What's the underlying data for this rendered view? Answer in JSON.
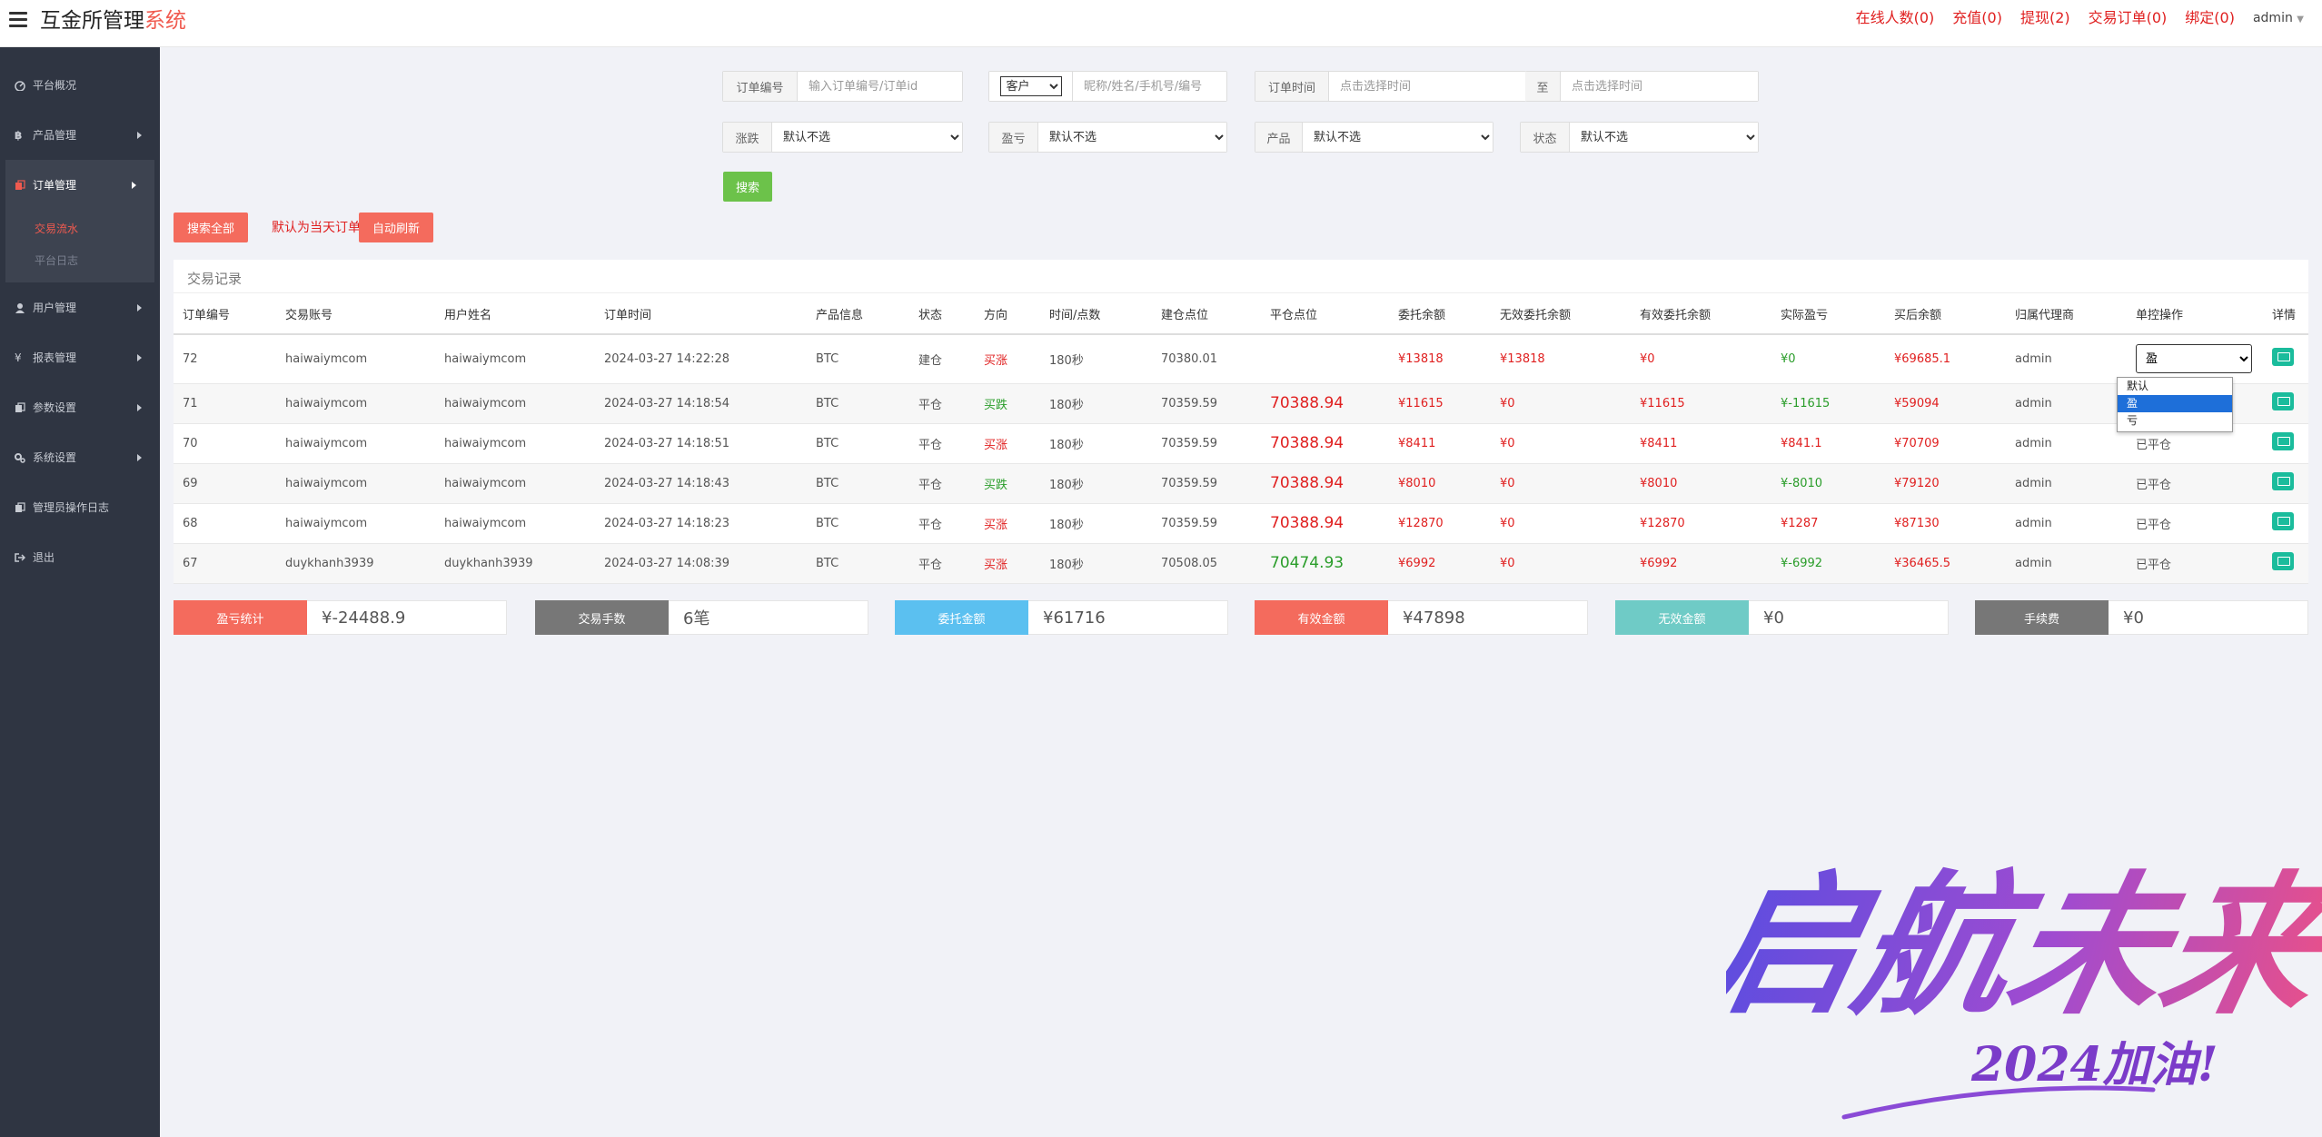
{
  "header": {
    "title_main": "互金所管理",
    "title_accent": "系统",
    "nav": [
      "在线人数(0)",
      "充值(0)",
      "提现(2)",
      "交易订单(0)",
      "绑定(0)"
    ],
    "user": "admin"
  },
  "sidebar": {
    "items": [
      {
        "label": "平台概况",
        "icon": "dashboard-icon"
      },
      {
        "label": "产品管理",
        "icon": "bitcoin-icon"
      },
      {
        "label": "订单管理",
        "icon": "copy-icon"
      },
      {
        "label": "用户管理",
        "icon": "user-icon"
      },
      {
        "label": "报表管理",
        "icon": "yen-icon"
      },
      {
        "label": "参数设置",
        "icon": "copy-icon"
      },
      {
        "label": "系统设置",
        "icon": "gears-icon"
      },
      {
        "label": "管理员操作日志",
        "icon": "copy-icon"
      },
      {
        "label": "退出",
        "icon": "sign-out-icon"
      }
    ],
    "sub": [
      "交易流水",
      "平台日志"
    ]
  },
  "filters": {
    "order_no_label": "订单编号",
    "order_no_placeholder": "输入订单编号/订单id",
    "user_type": "客户",
    "user_placeholder": "昵称/姓名/手机号/编号",
    "time_label": "订单时间",
    "time_placeholder": "点击选择时间",
    "to_label": "至",
    "rise_label": "涨跌",
    "profit_label": "盈亏",
    "product_label": "产品",
    "status_label": "状态",
    "default_option": "默认不选",
    "search_btn": "搜索"
  },
  "actions": {
    "search_all": "搜索全部",
    "note": "默认为当天订单",
    "auto_refresh": "自动刷新"
  },
  "table": {
    "title": "交易记录",
    "columns": [
      "订单编号",
      "交易账号",
      "用户姓名",
      "订单时间",
      "产品信息",
      "状态",
      "方向",
      "时间/点数",
      "建仓点位",
      "平仓点位",
      "委托余额",
      "无效委托余额",
      "有效委托余额",
      "实际盈亏",
      "买后余额",
      "归属代理商",
      "单控操作",
      "详情"
    ],
    "rows": [
      {
        "id": "72",
        "account": "haiwaiymcom",
        "name": "haiwaiymcom",
        "time": "2024-03-27 14:22:28",
        "product": "BTC",
        "status": "建仓",
        "dir": "买涨",
        "dirc": "red",
        "dur": "180秒",
        "open": "70380.01",
        "close": "",
        "closec": "red",
        "amount": "¥13818",
        "invalid": "¥13818",
        "valid": "¥0",
        "pnl": "¥0",
        "pnlc": "grn",
        "after": "¥69685.1",
        "agent": "admin",
        "ctrl": "select"
      },
      {
        "id": "71",
        "account": "haiwaiymcom",
        "name": "haiwaiymcom",
        "time": "2024-03-27 14:18:54",
        "product": "BTC",
        "status": "平仓",
        "dir": "买跌",
        "dirc": "grn",
        "dur": "180秒",
        "open": "70359.59",
        "close": "70388.94",
        "closec": "red",
        "amount": "¥11615",
        "invalid": "¥0",
        "valid": "¥11615",
        "pnl": "¥-11615",
        "pnlc": "grn",
        "after": "¥59094",
        "agent": "admin",
        "ctrl": ""
      },
      {
        "id": "70",
        "account": "haiwaiymcom",
        "name": "haiwaiymcom",
        "time": "2024-03-27 14:18:51",
        "product": "BTC",
        "status": "平仓",
        "dir": "买涨",
        "dirc": "red",
        "dur": "180秒",
        "open": "70359.59",
        "close": "70388.94",
        "closec": "red",
        "amount": "¥8411",
        "invalid": "¥0",
        "valid": "¥8411",
        "pnl": "¥841.1",
        "pnlc": "red",
        "after": "¥70709",
        "agent": "admin",
        "ctrl": "已平仓"
      },
      {
        "id": "69",
        "account": "haiwaiymcom",
        "name": "haiwaiymcom",
        "time": "2024-03-27 14:18:43",
        "product": "BTC",
        "status": "平仓",
        "dir": "买跌",
        "dirc": "grn",
        "dur": "180秒",
        "open": "70359.59",
        "close": "70388.94",
        "closec": "red",
        "amount": "¥8010",
        "invalid": "¥0",
        "valid": "¥8010",
        "pnl": "¥-8010",
        "pnlc": "grn",
        "after": "¥79120",
        "agent": "admin",
        "ctrl": "已平仓"
      },
      {
        "id": "68",
        "account": "haiwaiymcom",
        "name": "haiwaiymcom",
        "time": "2024-03-27 14:18:23",
        "product": "BTC",
        "status": "平仓",
        "dir": "买涨",
        "dirc": "red",
        "dur": "180秒",
        "open": "70359.59",
        "close": "70388.94",
        "closec": "red",
        "amount": "¥12870",
        "invalid": "¥0",
        "valid": "¥12870",
        "pnl": "¥1287",
        "pnlc": "red",
        "after": "¥87130",
        "agent": "admin",
        "ctrl": "已平仓"
      },
      {
        "id": "67",
        "account": "duykhanh3939",
        "name": "duykhanh3939",
        "time": "2024-03-27 14:08:39",
        "product": "BTC",
        "status": "平仓",
        "dir": "买涨",
        "dirc": "red",
        "dur": "180秒",
        "open": "70508.05",
        "close": "70474.93",
        "closec": "grn",
        "amount": "¥6992",
        "invalid": "¥0",
        "valid": "¥6992",
        "pnl": "¥-6992",
        "pnlc": "grn",
        "after": "¥36465.5",
        "agent": "admin",
        "ctrl": "已平仓"
      }
    ],
    "ctrl_selected": "盈",
    "ctrl_options": [
      "默认",
      "盈",
      "亏"
    ]
  },
  "stats": [
    {
      "label": "盈亏统计",
      "value": "¥-24488.9",
      "color": "#f46b5d"
    },
    {
      "label": "交易手数",
      "value": "6笔",
      "color": "#777777"
    },
    {
      "label": "委托金额",
      "value": "¥61716",
      "color": "#5bc0f0"
    },
    {
      "label": "有效金额",
      "value": "¥47898",
      "color": "#f46b5d"
    },
    {
      "label": "无效金额",
      "value": "¥0",
      "color": "#6fcbc6"
    },
    {
      "label": "手续费",
      "value": "¥0",
      "color": "#777777"
    }
  ],
  "watermark": {
    "main": "启航未来",
    "sub": "2024加油!"
  },
  "colors": {
    "accent_red": "#f05a4f",
    "green_btn": "#6cc24a",
    "sidebar_bg": "#2f3542",
    "teal": "#1abc9c"
  }
}
